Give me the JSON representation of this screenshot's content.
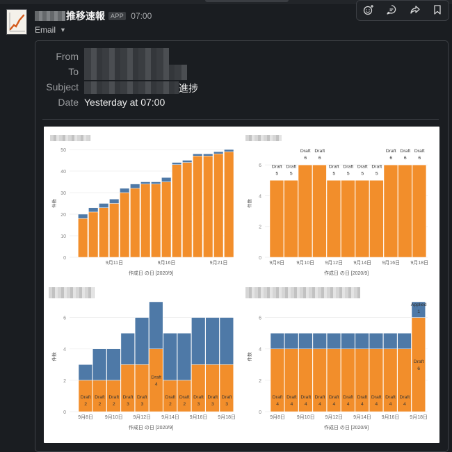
{
  "message": {
    "sender_name": "推移速報",
    "app_badge": "APP",
    "time": "07:00",
    "channel_menu": "Email"
  },
  "toolbar": {
    "icons": [
      "add-reaction-icon",
      "reply-thread-icon",
      "share-icon",
      "bookmark-icon"
    ]
  },
  "email": {
    "from_label": "From",
    "to_label": "To",
    "subject_label": "Subject",
    "subject_suffix": "進捗",
    "date_label": "Date",
    "date_value": "Yesterday at 07:00"
  },
  "colors": {
    "draft": "#f28e2b",
    "applied": "#4e79a7"
  },
  "chart_data": [
    {
      "type": "bar",
      "stacked": true,
      "x": [
        "9月8日",
        "9月9日",
        "9月10日",
        "9月11日",
        "9月12日",
        "9月13日",
        "9月14日",
        "9月15日",
        "9月16日",
        "9月17日",
        "9月18日",
        "9月19日",
        "9月20日",
        "9月21日",
        "9月22日"
      ],
      "series": [
        {
          "values": [
            18,
            21,
            23,
            25,
            30,
            32,
            34,
            34,
            35,
            43,
            44,
            47,
            47,
            48,
            49
          ]
        },
        {
          "values": [
            2,
            2,
            2,
            2,
            2,
            2,
            1,
            1,
            2,
            1,
            1,
            1,
            1,
            1,
            1
          ]
        }
      ],
      "xticks": [
        "9月11日",
        "9月16日",
        "9月21日"
      ],
      "xlabel": "作成日 の日 [2020/9]",
      "ylabel": "件数",
      "ylim": [
        0,
        50
      ],
      "yticks": [
        0,
        10,
        20,
        30,
        40,
        50
      ]
    },
    {
      "type": "bar",
      "x": [
        "9月8日",
        "9月9日",
        "9月10日",
        "9月11日",
        "9月12日",
        "9月13日",
        "9月14日",
        "9月15日",
        "9月16日",
        "9月17日",
        "9月18日"
      ],
      "series": [
        {
          "values": [
            5,
            5,
            6,
            6,
            5,
            5,
            5,
            5,
            6,
            6,
            6
          ],
          "labels": [
            "Draft\n5",
            "Draft\n5",
            "Draft\n6",
            "Draft\n6",
            "Draft\n5",
            "Draft\n5",
            "Draft\n5",
            "Draft\n5",
            "Draft\n6",
            "Draft\n6",
            "Draft\n6"
          ]
        }
      ],
      "xticks": [
        "9月8日",
        "9月10日",
        "9月12日",
        "9月14日",
        "9月16日",
        "9月18日"
      ],
      "xlabel": "作成日 の日 [2020/9]",
      "ylabel": "件数",
      "ylim": [
        0,
        7
      ],
      "yticks": [
        0,
        2,
        4,
        6
      ]
    },
    {
      "type": "bar",
      "stacked": true,
      "x": [
        "9月8日",
        "9月9日",
        "9月10日",
        "9月11日",
        "9月12日",
        "9月13日",
        "9月14日",
        "9月15日",
        "9月16日",
        "9月17日",
        "9月18日"
      ],
      "series": [
        {
          "values": [
            2,
            2,
            2,
            3,
            3,
            4,
            2,
            2,
            3,
            3,
            3
          ],
          "labels": [
            "Draft\n2",
            "Draft\n2",
            "Draft\n2",
            "Draft\n3",
            "Draft\n3",
            "Draft\n4",
            "Draft\n2",
            "Draft\n2",
            "Draft\n3",
            "Draft\n3",
            "Draft\n3"
          ]
        },
        {
          "values": [
            1,
            2,
            2,
            2,
            3,
            3,
            3,
            3,
            3,
            3,
            3
          ]
        }
      ],
      "xticks": [
        "9月8日",
        "9月10日",
        "9月12日",
        "9月14日",
        "9月16日",
        "9月18日"
      ],
      "xlabel": "作成日 の日 [2020/9]",
      "ylabel": "件数",
      "ylim": [
        0,
        7
      ],
      "yticks": [
        0,
        2,
        4,
        6
      ]
    },
    {
      "type": "bar",
      "stacked": true,
      "x": [
        "9月8日",
        "9月9日",
        "9月10日",
        "9月11日",
        "9月12日",
        "9月13日",
        "9月14日",
        "9月15日",
        "9月16日",
        "9月17日",
        "9月18日"
      ],
      "series": [
        {
          "values": [
            4,
            4,
            4,
            4,
            4,
            4,
            4,
            4,
            4,
            4,
            6
          ],
          "labels": [
            "Draft\n4",
            "Draft\n4",
            "Draft\n4",
            "Draft\n4",
            "Draft\n4",
            "Draft\n4",
            "Draft\n4",
            "Draft\n4",
            "Draft\n4",
            "Draft\n4",
            "Draft\n6"
          ]
        },
        {
          "values": [
            1,
            1,
            1,
            1,
            1,
            1,
            1,
            1,
            1,
            1,
            1
          ],
          "labels": [
            "",
            "",
            "",
            "",
            "",
            "",
            "",
            "",
            "",
            "",
            "Applied\n1"
          ]
        }
      ],
      "xticks": [
        "9月8日",
        "9月10日",
        "9月12日",
        "9月14日",
        "9月16日",
        "9月18日"
      ],
      "xlabel": "作成日 の日 [2020/9]",
      "ylabel": "件数",
      "ylim": [
        0,
        7
      ],
      "yticks": [
        0,
        2,
        4,
        6
      ]
    }
  ]
}
